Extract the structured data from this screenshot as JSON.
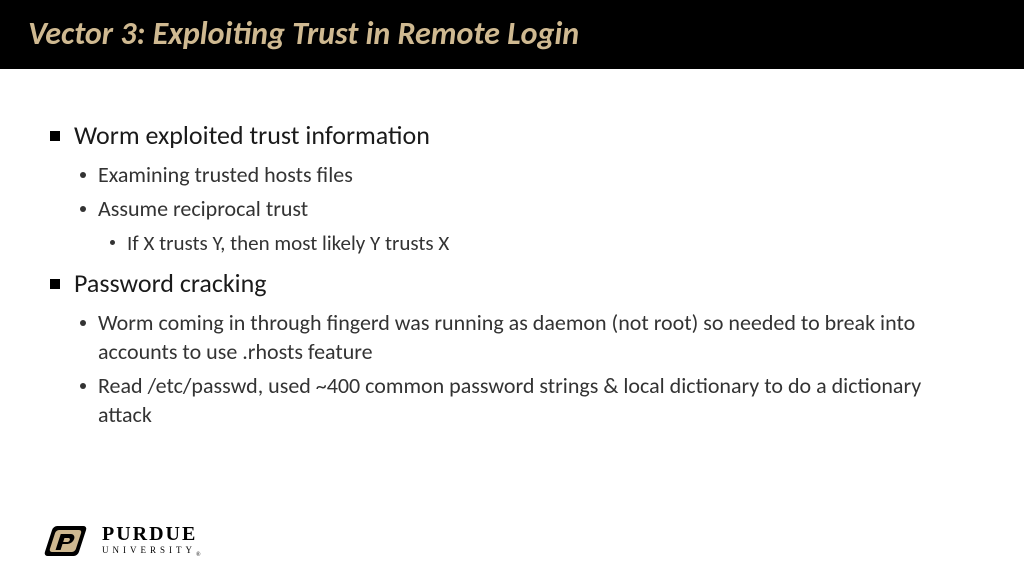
{
  "title": "Vector 3: Exploiting Trust in Remote Login",
  "bullets": [
    {
      "text": "Worm exploited trust information",
      "children": [
        {
          "text": "Examining trusted hosts files"
        },
        {
          "text": "Assume reciprocal trust",
          "children": [
            {
              "text": "If X trusts Y, then most likely Y trusts X"
            }
          ]
        }
      ]
    },
    {
      "text": "Password cracking",
      "children": [
        {
          "text": "Worm coming in through fingerd was running as daemon (not root) so needed to break into accounts to use .rhosts feature"
        },
        {
          "text": "Read /etc/passwd, used ~400 common password strings & local dictionary to do a dictionary attack"
        }
      ]
    }
  ],
  "logo": {
    "main": "PURDUE",
    "sub": "UNIVERSITY",
    "accent": "#cfb991"
  }
}
